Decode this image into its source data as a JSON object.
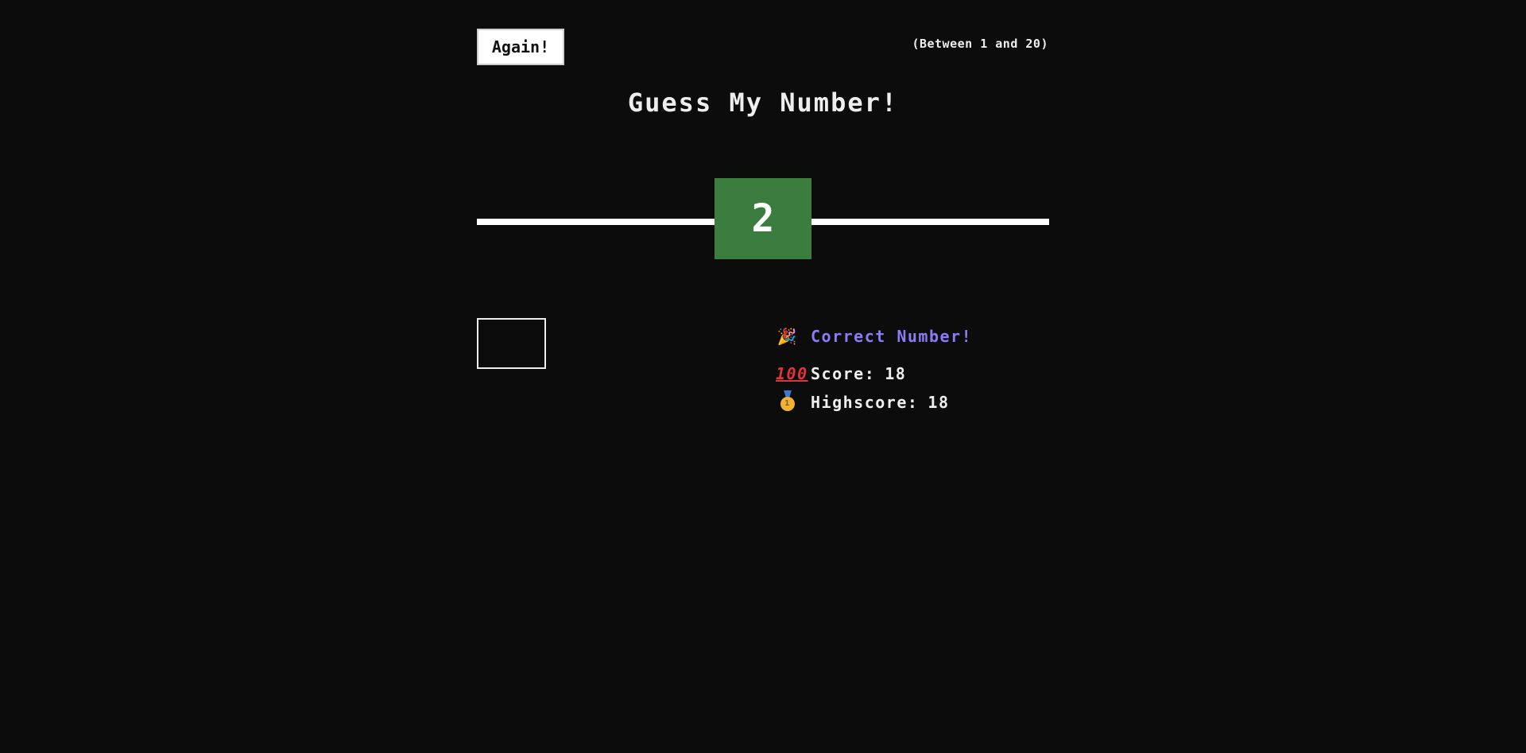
{
  "header": {
    "again_label": "Again!",
    "range_hint": "(Between 1 and 20)"
  },
  "title": "Guess My Number!",
  "secret_number": "2",
  "guess": {
    "value": ""
  },
  "message": {
    "icon": "party-popper-icon",
    "text": "Correct Number!"
  },
  "score": {
    "icon": "hundred-points-icon",
    "icon_glyph": "100",
    "label": "Score:",
    "value": "18"
  },
  "highscore": {
    "icon": "medal-icon",
    "medal_glyph": "1",
    "label": "Highscore:",
    "value": "18"
  },
  "colors": {
    "background": "#0c0c0c",
    "number_box": "#3a7d3f",
    "message": "#8b7cf6",
    "text": "#eeeeee"
  }
}
